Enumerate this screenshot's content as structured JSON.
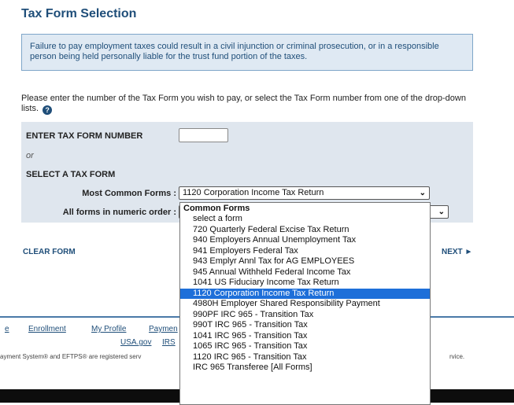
{
  "page": {
    "title": "Tax Form Selection",
    "warning": "Failure to pay employment taxes could result in a civil injunction or criminal prosecution, or in a responsible person being held personally liable for the trust fund portion of the taxes.",
    "instructions": "Please enter the number of the Tax Form you wish to pay, or select the Tax Form number from one of the drop-down lists.",
    "help_icon": "?"
  },
  "form": {
    "enter_label": "ENTER TAX FORM NUMBER",
    "enter_value": "",
    "or_label": "or",
    "select_label": "SELECT A TAX FORM",
    "common_label": "Most Common Forms :",
    "common_selected": "1120 Corporation Income Tax Return",
    "numeric_label": "All forms in numeric order :",
    "numeric_selected": "",
    "clear_label": "CLEAR FORM",
    "next_label": "NEXT ►"
  },
  "footer": {
    "links_row1": [
      "Enrollment",
      "My Profile",
      "Paymen"
    ],
    "links_row2": [
      "USA.gov",
      "IRS"
    ],
    "left_fragment": "e",
    "disclaimer_left": "ayment System® and EFTPS® are registered serv",
    "disclaimer_right": "rvice."
  },
  "dropdown": {
    "group_label": "Common Forms",
    "selected_index": 8,
    "options": [
      "select a form",
      "720 Quarterly Federal Excise Tax Return",
      "940 Employers Annual Unemployment Tax",
      "941 Employers Federal Tax",
      "943 Emplyr Annl Tax for AG EMPLOYEES",
      "945 Annual Withheld Federal Income Tax",
      "1041 US Fiduciary Income Tax Return",
      "1120 Corporation Income Tax Return",
      "4980H Employer Shared Responsibility Payment",
      "990PF IRC 965 - Transition Tax",
      "990T IRC 965 - Transition Tax",
      "1041 IRC 965 - Transition Tax",
      "1065 IRC 965 - Transition Tax",
      "1120 IRC 965 - Transition Tax",
      "IRC 965 Transferee [All Forms]"
    ]
  },
  "colors": {
    "primary": "#1f4e79",
    "panel": "#dfe6ee",
    "selection": "#1e6fd9"
  }
}
